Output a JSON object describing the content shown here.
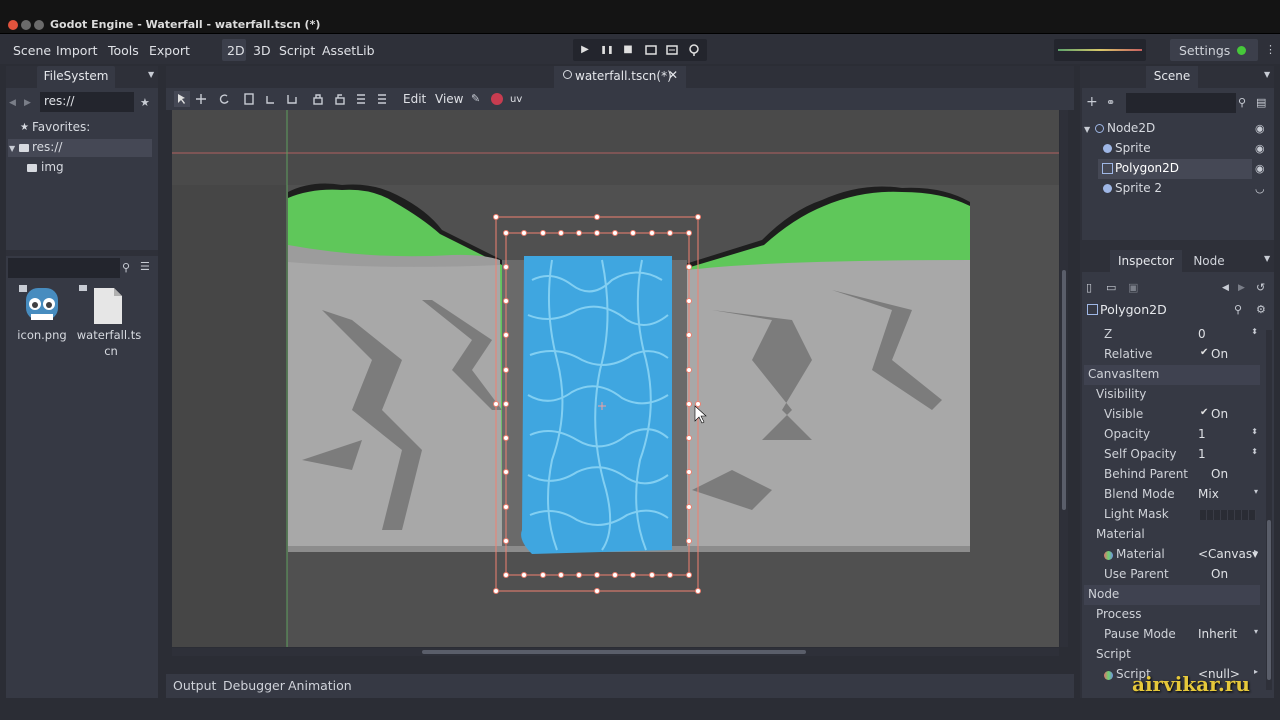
{
  "window": {
    "title": "Godot Engine - Waterfall - waterfall.tscn (*)"
  },
  "menu": [
    "Scene",
    "Import",
    "Tools",
    "Export"
  ],
  "modes": [
    "2D",
    "3D",
    "Script",
    "AssetLib"
  ],
  "playback": {
    "play": "▶",
    "pause": "❚❚",
    "stop": "■"
  },
  "settings_label": "Settings",
  "filesystem": {
    "tab": "FileSystem",
    "path": "res://",
    "favorites_label": "Favorites:",
    "tree": [
      "res://",
      "img"
    ],
    "files": [
      {
        "name_line1": "icon.png",
        "name_line2": ""
      },
      {
        "name_line1": "waterfall.ts",
        "name_line2": "cn"
      }
    ]
  },
  "editor": {
    "scene_tab": "waterfall.tscn(*)",
    "toolbar_menus": [
      "Edit",
      "View"
    ],
    "uv_label": "uv"
  },
  "bottom_tabs": [
    "Output",
    "Debugger",
    "Animation"
  ],
  "scene_panel": {
    "tab": "Scene",
    "nodes": [
      "Node2D",
      "Sprite",
      "Polygon2D",
      "Sprite 2"
    ]
  },
  "inspector": {
    "tabs": [
      "Inspector",
      "Node"
    ],
    "object": "Polygon2D",
    "rows": [
      {
        "k": "Z",
        "v": "0",
        "type": "spin"
      },
      {
        "k": "Relative",
        "v": "On",
        "check": "✔",
        "type": "check"
      },
      {
        "k": "CanvasItem",
        "type": "section"
      },
      {
        "k": "Visibility",
        "type": "group"
      },
      {
        "k": "Visible",
        "v": "On",
        "check": "✔",
        "type": "check"
      },
      {
        "k": "Opacity",
        "v": "1",
        "type": "spin"
      },
      {
        "k": "Self Opacity",
        "v": "1",
        "type": "spin"
      },
      {
        "k": "Behind Parent",
        "v": "On",
        "type": "check"
      },
      {
        "k": "Blend Mode",
        "v": "Mix",
        "type": "enum"
      },
      {
        "k": "Light Mask",
        "v": "",
        "type": "mask"
      },
      {
        "k": "Material",
        "type": "group"
      },
      {
        "k": "Material",
        "v": "<Canvas▾",
        "type": "res"
      },
      {
        "k": "Use Parent",
        "v": "On",
        "type": "check"
      },
      {
        "k": "Node",
        "type": "section"
      },
      {
        "k": "Process",
        "type": "group"
      },
      {
        "k": "Pause Mode",
        "v": "Inherit",
        "type": "enum"
      },
      {
        "k": "Script",
        "type": "group"
      },
      {
        "k": "Script",
        "v": "<null>",
        "type": "res"
      }
    ]
  },
  "watermark": "airvikar.ru",
  "colors": {
    "selection": "#f08070",
    "accent": "#46c83a",
    "water": "#3fa6e0"
  }
}
